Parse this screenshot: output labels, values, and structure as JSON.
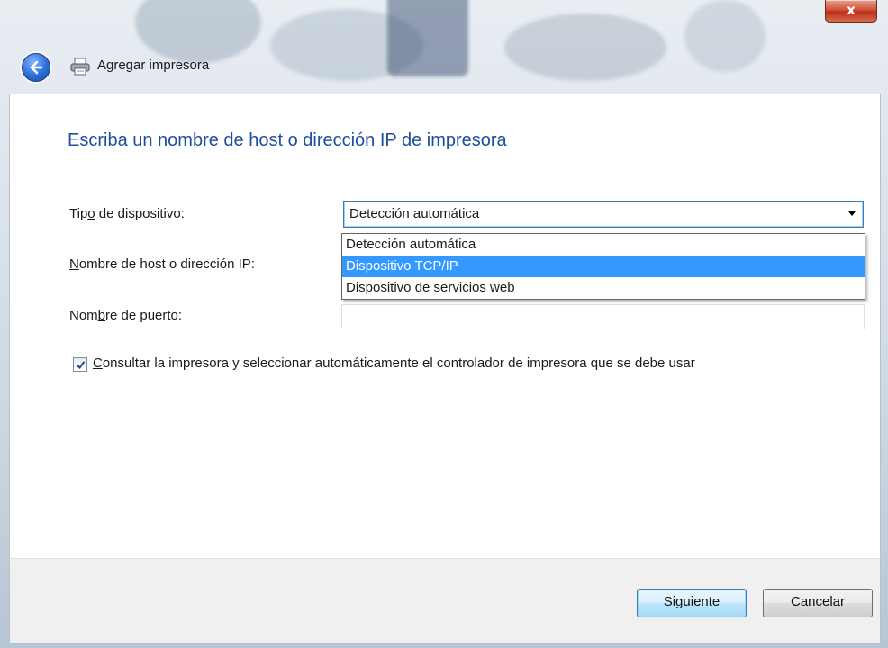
{
  "window": {
    "title": "Agregar impresora",
    "close_label": "x"
  },
  "page": {
    "heading": "Escriba un nombre de host o dirección IP de impresora"
  },
  "form": {
    "device_type_label_pre": "Tip",
    "device_type_label_u": "o",
    "device_type_label_post": " de dispositivo:",
    "host_label_u": "N",
    "host_label_post": "ombre de host o dirección IP:",
    "port_label_pre": "Nom",
    "port_label_u": "b",
    "port_label_post": "re de puerto:",
    "device_type_value": "Detección automática",
    "device_type_options": [
      "Detección automática",
      "Dispositivo TCP/IP",
      "Dispositivo de servicios web"
    ],
    "device_type_highlighted_index": 1,
    "host_value": "",
    "port_value": "",
    "query_checkbox_u": "C",
    "query_checkbox_post": "onsultar la impresora y seleccionar automáticamente el controlador de impresora que se debe usar",
    "query_checkbox_checked": true
  },
  "footer": {
    "next_label": "Siguiente",
    "cancel_label": "Cancelar"
  },
  "colors": {
    "heading": "#1e4e9c",
    "selection": "#3399ff",
    "close_button": "#c83a1f"
  },
  "icons": [
    "back-arrow-icon",
    "printer-icon",
    "close-icon",
    "chevron-down-icon",
    "checkmark-icon"
  ]
}
